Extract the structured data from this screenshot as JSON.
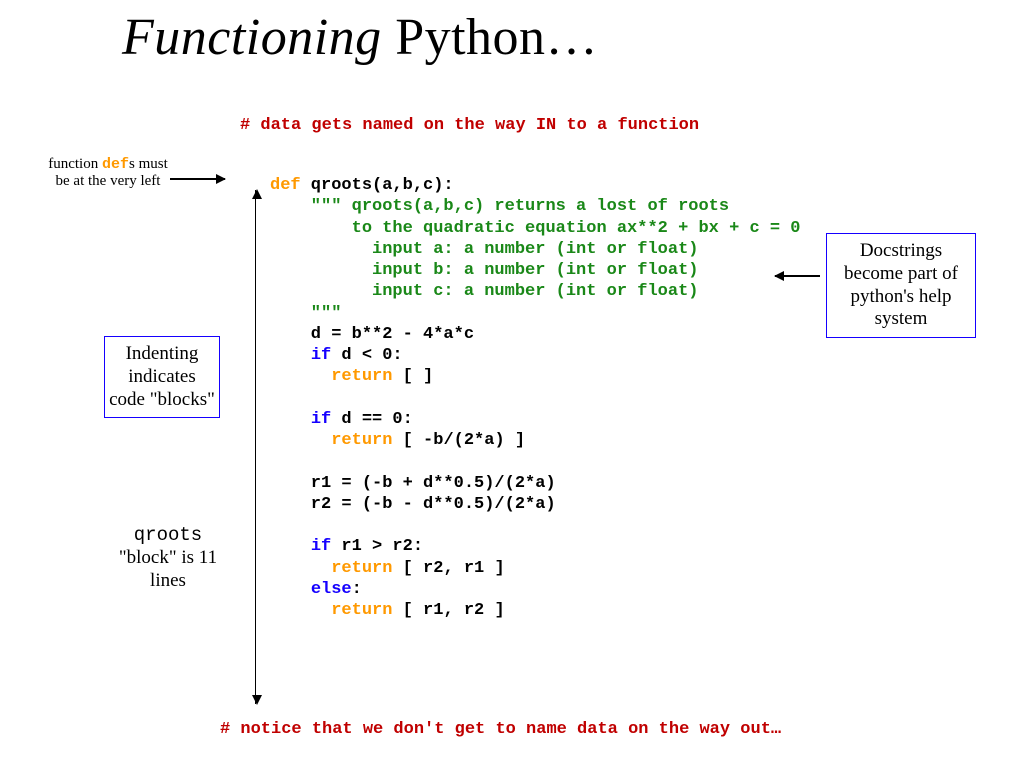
{
  "title_part1": "Functioning",
  "title_part2": " Python…",
  "top_comment": "# data gets named on the way IN to a function",
  "deftop_note_pre": "function ",
  "deftop_note_def": "def",
  "deftop_note_post": "s must be at the very left",
  "code": {
    "defline_pre": "def",
    "defline_rest": " qroots(a,b,c):",
    "doc1": "    \"\"\" qroots(a,b,c) returns a lost of roots",
    "doc2": "        to the quadratic equation ax**2 + bx + c = 0",
    "doc3": "          input a: a number (int or float)",
    "doc4": "          input b: a number (int or float)",
    "doc5": "          input c: a number (int or float)",
    "docend": "    \"\"\"",
    "dline": "    d = b**2 - 4*a*c",
    "if_d_lt0_pre": "    ",
    "if_kw": "if",
    "if_d_lt0_cond": " d < 0:",
    "ret_kw": "return",
    "ret_empty_val": " [ ]",
    "blank": "",
    "if_d_eq0_cond": " d == 0:",
    "ret_b2a_val": " [ -b/(2*a) ]",
    "r1": "    r1 = (-b + d**0.5)/(2*a)",
    "r2": "    r2 = (-b - d**0.5)/(2*a)",
    "if_r1gtr2_cond": " r1 > r2:",
    "ret_r2r1_val": " [ r2, r1 ]",
    "else_kw": "else",
    "else_colon": ":",
    "ret_r1r2_val": " [ r1, r2 ]",
    "indent4": "    ",
    "indent6": "      "
  },
  "right_box": "Docstrings become part of python's help system",
  "left_box": "Indenting indicates code \"blocks\"",
  "qroots_note_l1": "qroots",
  "qroots_note_l2": "\"block\" is 11 lines",
  "bottom_comment": "# notice that we don't get to name data on the way out…"
}
